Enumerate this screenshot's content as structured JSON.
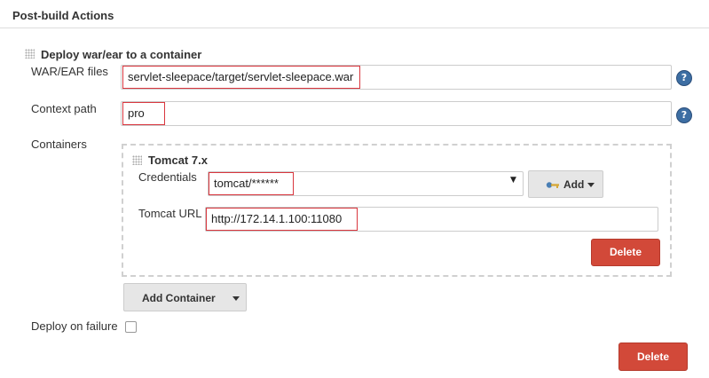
{
  "section": {
    "title": "Post-build Actions"
  },
  "deploy": {
    "title": "Deploy war/ear to a container",
    "war_label": "WAR/EAR files",
    "war_value": "servlet-sleepace/target/servlet-sleepace.war",
    "context_label": "Context path",
    "context_value": "pro",
    "containers_label": "Containers",
    "help_glyph": "?"
  },
  "tomcat": {
    "title": "Tomcat 7.x",
    "credentials_label": "Credentials",
    "credentials_value": "tomcat/******",
    "select_arrow": "▼",
    "add_label": "Add",
    "url_label": "Tomcat URL",
    "url_value": "http://172.14.1.100:11080",
    "delete_label": "Delete"
  },
  "add_container": {
    "label": "Add Container"
  },
  "deploy_on_failure": {
    "label": "Deploy on failure",
    "checked": false
  },
  "delete_label": "Delete",
  "colors": {
    "highlight": "#d9363e",
    "delete_bg": "#d24939",
    "help_bg": "#3d6ea3"
  },
  "icons": {
    "grip": "drag-handle-icon",
    "help": "help-icon",
    "key": "key-icon",
    "caret": "caret-down-icon"
  }
}
